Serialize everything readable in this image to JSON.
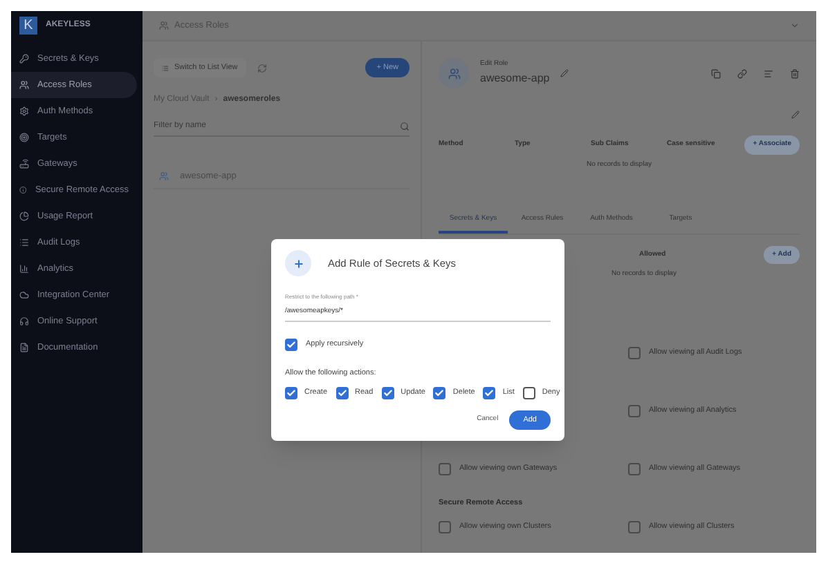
{
  "brand": {
    "logo": "K",
    "name": "AKEYLESS"
  },
  "sidebar": {
    "items": [
      {
        "label": "Secrets & Keys",
        "selected": false
      },
      {
        "label": "Access Roles",
        "selected": true
      },
      {
        "label": "Auth Methods",
        "selected": false
      },
      {
        "label": "Targets",
        "selected": false
      },
      {
        "label": "Gateways",
        "selected": false
      },
      {
        "label": "Secure Remote Access",
        "selected": false
      },
      {
        "label": "Usage Report",
        "selected": false
      },
      {
        "label": "Audit Logs",
        "selected": false
      },
      {
        "label": "Analytics",
        "selected": false
      },
      {
        "label": "Integration Center",
        "selected": false
      },
      {
        "label": "Online Support",
        "selected": false
      },
      {
        "label": "Documentation",
        "selected": false
      }
    ]
  },
  "header": {
    "title": "Access Roles"
  },
  "left_panel": {
    "switch_button": "Switch to List View",
    "new_button": "+ New",
    "breadcrumb": [
      "My Cloud Vault",
      "awesomeroles"
    ],
    "breadcrumb_separator": "›",
    "search": {
      "placeholder": "Filter by name"
    },
    "items": [
      {
        "label": "awesome-app"
      }
    ]
  },
  "role": {
    "caption": "Edit Role",
    "name": "awesome-app",
    "table": {
      "columns": [
        "Method",
        "Type",
        "Sub Claims",
        "Case sensitive"
      ],
      "button": "+ Associate",
      "empty": "No records to display"
    },
    "tabs": [
      {
        "label": "Secrets & Keys",
        "selected": true
      },
      {
        "label": "Access Rules",
        "selected": false
      },
      {
        "label": "Auth Methods",
        "selected": false
      },
      {
        "label": "Targets",
        "selected": false
      }
    ],
    "rules_table": {
      "columns": [
        "Allowed"
      ],
      "button": "+ Add",
      "empty": "No records to display"
    },
    "permissions": [
      {
        "kind": "row",
        "right": {
          "label": "Allow viewing all Audit Logs",
          "checked": false
        }
      },
      {
        "kind": "row",
        "right": {
          "label": "Allow viewing all Analytics",
          "checked": false
        }
      },
      {
        "kind": "row",
        "left": {
          "label": "Allow viewing own Gateways",
          "checked": false
        },
        "right": {
          "label": "Allow viewing all Gateways",
          "checked": false
        }
      },
      {
        "kind": "heading",
        "label": "Secure Remote Access"
      },
      {
        "kind": "row",
        "left": {
          "label": "Allow viewing own Clusters",
          "checked": false
        },
        "right": {
          "label": "Allow viewing all Clusters",
          "checked": false
        }
      }
    ]
  },
  "dialog": {
    "title": "Add Rule of Secrets & Keys",
    "path_label": "Restrict to the following path *",
    "path_value": "/awesomeapkeys/*",
    "recursive": {
      "label": "Apply recursively",
      "checked": true
    },
    "actions_label": "Allow the following actions:",
    "actions": [
      {
        "label": "Create",
        "checked": true
      },
      {
        "label": "Read",
        "checked": true
      },
      {
        "label": "Update",
        "checked": true
      },
      {
        "label": "Delete",
        "checked": true
      },
      {
        "label": "List",
        "checked": true
      },
      {
        "label": "Deny",
        "checked": false
      }
    ],
    "buttons": [
      {
        "label": "Cancel",
        "kind": "text"
      },
      {
        "label": "Add",
        "kind": "primary"
      }
    ]
  }
}
